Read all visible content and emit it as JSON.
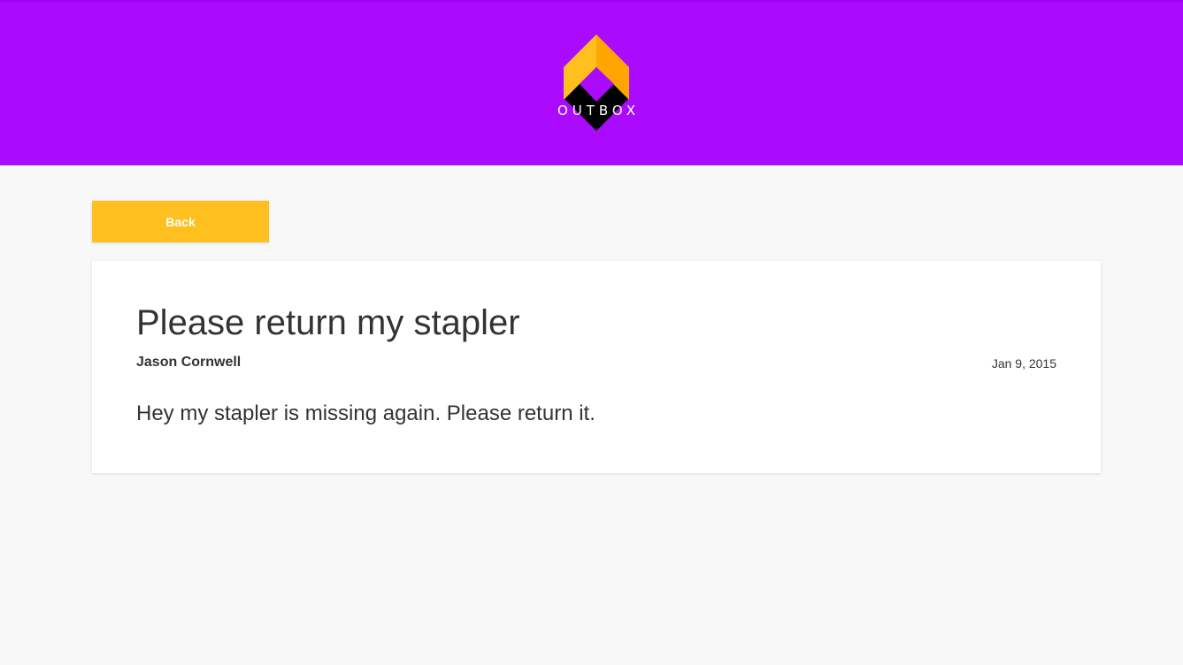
{
  "header": {
    "background_color": "#aa0afe",
    "logo": {
      "text": "OUTBOX",
      "icon": "outbox-logo-icon",
      "colors": {
        "left": "#ffbf1f",
        "right": "#ffa500",
        "bottom": "#000000",
        "notch": "#aa0afe"
      }
    }
  },
  "toolbar": {
    "back_label": "Back",
    "back_color": "#ffbf1f"
  },
  "message": {
    "title": "Please return my stapler",
    "author": "Jason Cornwell",
    "date": "Jan 9, 2015",
    "body": "Hey my stapler is missing again. Please return it."
  }
}
